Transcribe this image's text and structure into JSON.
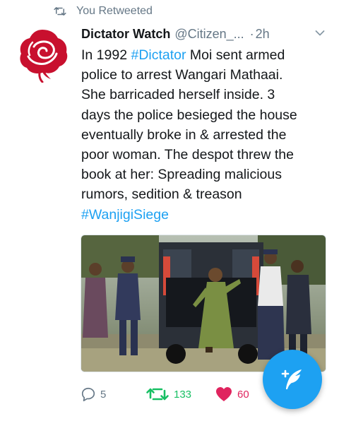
{
  "retweet_context": {
    "icon": "retweet-icon",
    "label": "You Retweeted"
  },
  "tweet": {
    "author_name": "Dictator Watch",
    "handle": "@Citizen_...",
    "separator": "·",
    "time": "2h",
    "text_lines": [
      {
        "parts": [
          {
            "t": "In 1992 "
          },
          {
            "t": "#Dictator",
            "tag": true
          },
          {
            "t": " Moi sent armed"
          }
        ]
      },
      {
        "parts": [
          {
            "t": "police to arrest Wangari Mathaai."
          }
        ]
      },
      {
        "parts": [
          {
            "t": "She barricaded herself inside. 3"
          }
        ]
      },
      {
        "parts": [
          {
            "t": "days the police besieged the house"
          }
        ]
      },
      {
        "parts": [
          {
            "t": "eventually broke in & arrested the"
          }
        ]
      },
      {
        "parts": [
          {
            "t": "poor woman. The despot threw the"
          }
        ]
      },
      {
        "parts": [
          {
            "t": "book at her: Spreading malicious"
          }
        ]
      },
      {
        "parts": [
          {
            "t": "rumors, sedition & treason"
          }
        ]
      },
      {
        "parts": [
          {
            "t": "#WanjigiSiege",
            "tag": true
          }
        ]
      }
    ],
    "media_icon": "news-photo"
  },
  "actions": {
    "reply_count": "5",
    "retweet_count": "133",
    "like_count": "60"
  },
  "compose_button": {
    "icon": "compose-feather-icon"
  },
  "colors": {
    "accent": "#1da1f2",
    "retweet": "#17bf63",
    "like": "#e0245e",
    "muted": "#657786",
    "avatar_red": "#c8102e"
  }
}
